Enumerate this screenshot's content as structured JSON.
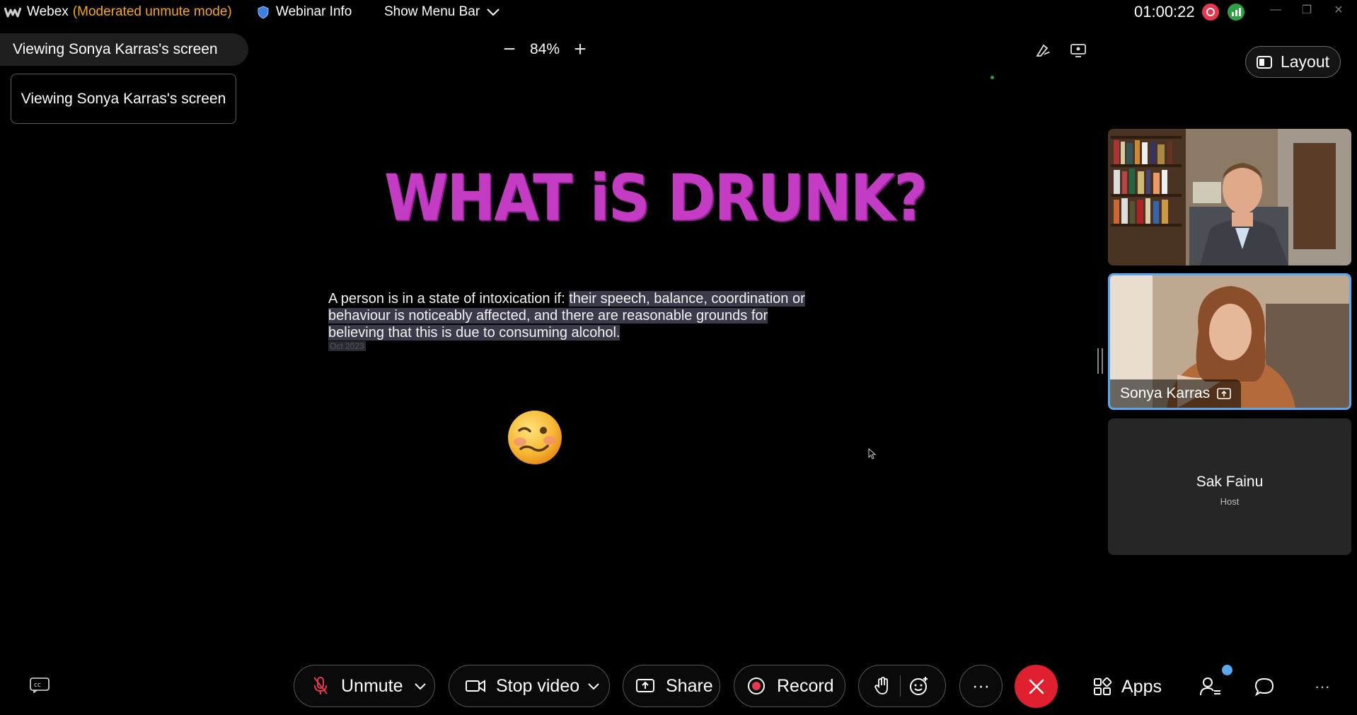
{
  "titlebar": {
    "app_name": "Webex",
    "mode": "(Moderated unmute mode)",
    "webinar_info": "Webinar Info",
    "show_menu_bar": "Show Menu Bar",
    "timer": "01:00:22",
    "min_glyph": "—",
    "max_glyph": "❐",
    "close_glyph": "✕"
  },
  "viewing": {
    "pill_label": "Viewing Sonya Karras's screen",
    "box_label": "Viewing Sonya Karras's screen"
  },
  "zoom": {
    "minus": "−",
    "value": "84%",
    "plus": "+"
  },
  "layout_label": "Layout",
  "slide": {
    "title": "WHAT iS DRUNK?",
    "body_plain": "A person is in a state of intoxication if: ",
    "body_highlight": "their speech, balance, coordination or behaviour is noticeably affected, and there are reasonable grounds for believing that this is due to consuming alcohol.",
    "reference": "Oct 2023"
  },
  "participants": [
    {
      "name": "",
      "role": ""
    },
    {
      "name": "Sonya Karras",
      "role": ""
    },
    {
      "name": "Sak Fainu",
      "role": "Host"
    }
  ],
  "controls": {
    "unmute": "Unmute",
    "stop_video": "Stop video",
    "share": "Share",
    "record": "Record",
    "more": "···",
    "apps": "Apps",
    "overflow": "···"
  },
  "colors": {
    "accent_mode": "#f5a623",
    "title_magenta": "#c43cc4",
    "active_speaker_border": "#5aa8f0",
    "end_call": "#e0202e",
    "record_red": "#e8384f",
    "network_green": "#2ea043"
  }
}
